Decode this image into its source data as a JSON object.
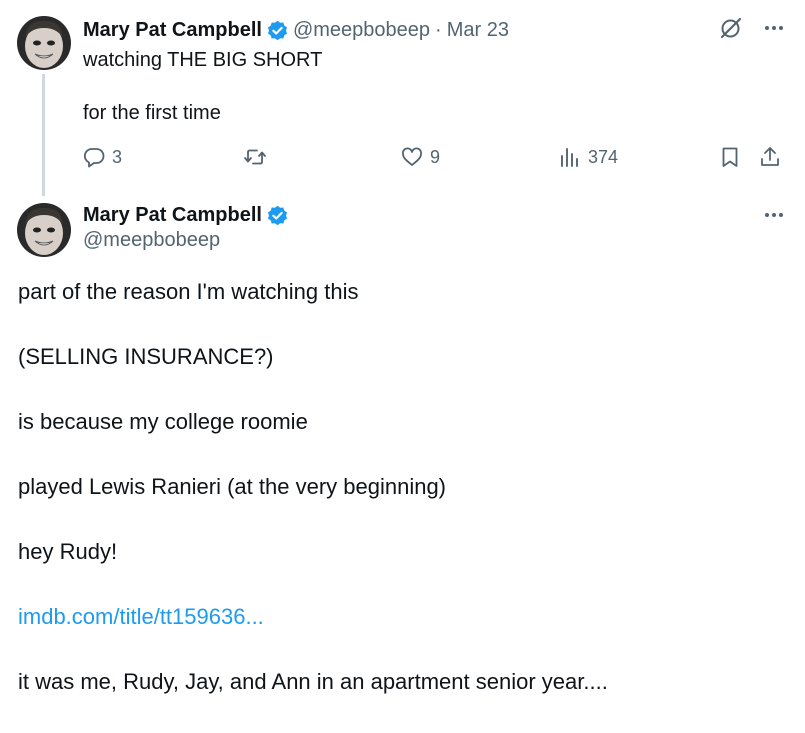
{
  "tweet1": {
    "author": {
      "display_name": "Mary Pat Campbell",
      "handle": "@meepbobeep",
      "verified": true
    },
    "separator": "·",
    "date": "Mar 23",
    "text_lines": [
      "watching THE BIG SHORT",
      "for the first time"
    ],
    "actions": {
      "replies": "3",
      "retweets": "",
      "likes": "9",
      "views": "374"
    },
    "icons": {
      "reply": "reply-icon",
      "retweet": "retweet-icon",
      "like": "heart-icon",
      "views": "views-icon",
      "bookmark": "bookmark-icon",
      "share": "share-icon",
      "grok": "grok-icon",
      "more": "more-icon"
    }
  },
  "tweet2": {
    "author": {
      "display_name": "Mary Pat Campbell",
      "handle": "@meepbobeep",
      "verified": true
    },
    "paragraphs": [
      "part of the reason I'm watching this",
      "(SELLING INSURANCE?)",
      "is because my college roomie",
      "played Lewis Ranieri (at the very beginning)",
      "hey Rudy!"
    ],
    "link_text": "imdb.com/title/tt159636...",
    "closing": "it was me, Rudy, Jay, and Ann in an apartment senior year...."
  },
  "colors": {
    "text": "#0f1419",
    "secondary": "#536471",
    "link": "#1d9bf0",
    "verified_badge": "#1d9bf0",
    "thread_line": "#cfd9de"
  }
}
